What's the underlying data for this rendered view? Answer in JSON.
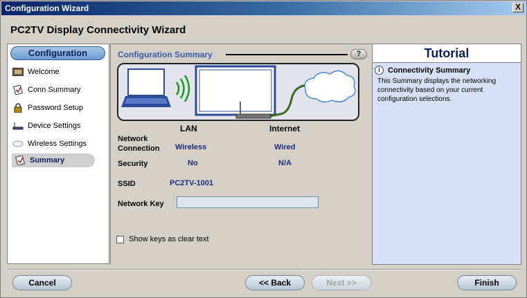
{
  "window": {
    "title": "Configuration Wizard",
    "close_label": "X"
  },
  "heading": "PC2TV Display Connectivity Wizard",
  "sidebar": {
    "header": "Configuration",
    "items": [
      {
        "label": "Welcome",
        "icon": "welcome-icon"
      },
      {
        "label": "Conn Summary",
        "icon": "conn-summary-icon"
      },
      {
        "label": "Password Setup",
        "icon": "lock-icon"
      },
      {
        "label": "Device Settings",
        "icon": "device-icon"
      },
      {
        "label": "Wireless Settings",
        "icon": "wireless-icon"
      },
      {
        "label": "Summary",
        "icon": "summary-icon",
        "active": true
      }
    ]
  },
  "main": {
    "section_title": "Configuration Summary",
    "help_label": "?",
    "columns": {
      "lan": "LAN",
      "internet": "Internet"
    },
    "rows": {
      "network_connection": {
        "label_line1": "Network",
        "label_line2": "Connection",
        "lan": "Wireless",
        "internet": "Wired"
      },
      "security": {
        "label": "Security",
        "lan": "No",
        "internet": "N/A"
      },
      "ssid": {
        "label": "SSID",
        "value": "PC2TV-1001"
      },
      "network_key": {
        "label": "Network Key",
        "value": ""
      }
    },
    "show_keys_label": "Show keys as clear text",
    "show_keys_checked": false
  },
  "tutorial": {
    "title": "Tutorial",
    "info_icon": "i",
    "subtitle": "Connectivity Summary",
    "body": "This Summary displays the networking connectivity based on your current configuration selections."
  },
  "buttons": {
    "cancel": "Cancel",
    "back": "<< Back",
    "next": "Next >>",
    "finish": "Finish"
  },
  "colors": {
    "accent": "#0b1f5c",
    "value_text": "#1e2a7a",
    "tutorial_bg": "#d8e0f8"
  }
}
